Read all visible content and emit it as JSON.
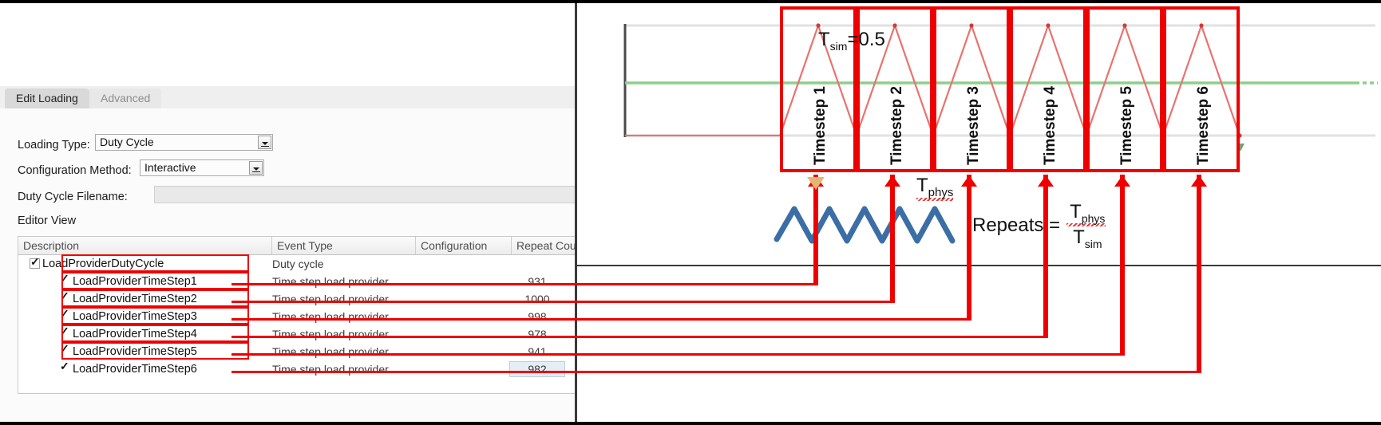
{
  "dialog": {
    "tabs": [
      {
        "label": "Edit Loading",
        "active": true
      },
      {
        "label": "Advanced",
        "active": false
      }
    ],
    "fields": {
      "loading_type_label": "Loading Type:",
      "loading_type_value": "Duty Cycle",
      "configuration_method_label": "Configuration Method:",
      "configuration_method_value": "Interactive",
      "duty_cycle_filename_label": "Duty Cycle Filename:",
      "duty_cycle_filename_value": ""
    },
    "editor_view_label": "Editor View",
    "table": {
      "columns": [
        "Description",
        "Event Type",
        "Configuration",
        "Repeat Count"
      ],
      "rows": [
        {
          "description": "LoadProviderDutyCycle",
          "event_type": "Duty cycle",
          "configuration": "",
          "repeat_count": "",
          "level": 0,
          "expanded": true,
          "checked": true,
          "highlighted": false
        },
        {
          "description": "LoadProviderTimeStep1",
          "event_type": "Time step load provider",
          "configuration": "",
          "repeat_count": "931",
          "level": 1,
          "expanded": false,
          "checked": true,
          "highlighted": true
        },
        {
          "description": "LoadProviderTimeStep2",
          "event_type": "Time step load provider",
          "configuration": "",
          "repeat_count": "1000",
          "level": 1,
          "expanded": false,
          "checked": true,
          "highlighted": true
        },
        {
          "description": "LoadProviderTimeStep3",
          "event_type": "Time step load provider",
          "configuration": "",
          "repeat_count": "998",
          "level": 1,
          "expanded": false,
          "checked": true,
          "highlighted": true
        },
        {
          "description": "LoadProviderTimeStep4",
          "event_type": "Time step load provider",
          "configuration": "",
          "repeat_count": "978",
          "level": 1,
          "expanded": false,
          "checked": true,
          "highlighted": true
        },
        {
          "description": "LoadProviderTimeStep5",
          "event_type": "Time step load provider",
          "configuration": "",
          "repeat_count": "941",
          "level": 1,
          "expanded": false,
          "checked": true,
          "highlighted": true
        },
        {
          "description": "LoadProviderTimeStep6",
          "event_type": "Time step load provider",
          "configuration": "",
          "repeat_count": "982",
          "level": 1,
          "expanded": false,
          "checked": true,
          "highlighted": true
        }
      ]
    }
  },
  "diagram": {
    "timestep_boxes": [
      {
        "label": "Timestep 1"
      },
      {
        "label": "Timestep 2"
      },
      {
        "label": "Timestep 3"
      },
      {
        "label": "Timestep 4"
      },
      {
        "label": "Timestep 5"
      },
      {
        "label": "Timestep 6"
      }
    ],
    "tsim_annotation": "T",
    "tsim_sub": "sim",
    "tsim_value": "=0.5",
    "tphys_annotation": "T",
    "tphys_sub": "phys",
    "repeats_label": "Repeats =",
    "repeats_numerator": "T",
    "repeats_numerator_sub": "phys",
    "repeats_denominator": "T",
    "repeats_denominator_sub": "sim",
    "colors": {
      "highlight_red": "#ee0000",
      "signal_red": "#e8736f",
      "threshold_green": "#8cd08c",
      "physical_blue": "#3b6ea5",
      "gold_marker": "#e8b473"
    }
  },
  "chart_data": {
    "type": "line",
    "title": "",
    "xlabel": "",
    "ylabel": "",
    "series": [
      {
        "name": "simulated triangular load (red)",
        "color": "#e8736f",
        "description": "Triangular wave, one peak per timestep, 6 timesteps",
        "peaks_per_timestep": 1,
        "peak_value": 1.0,
        "trough_value": 0.0,
        "timesteps": 6
      },
      {
        "name": "threshold (green)",
        "color": "#8cd08c",
        "description": "Constant horizontal level",
        "value": 0.5
      },
      {
        "name": "physical load (blue zigzag)",
        "color": "#3b6ea5",
        "description": "High-frequency physical cycle under the timeline",
        "cycles": 4
      }
    ],
    "ylim": [
      0,
      1
    ],
    "grid": true,
    "legend": "none"
  }
}
